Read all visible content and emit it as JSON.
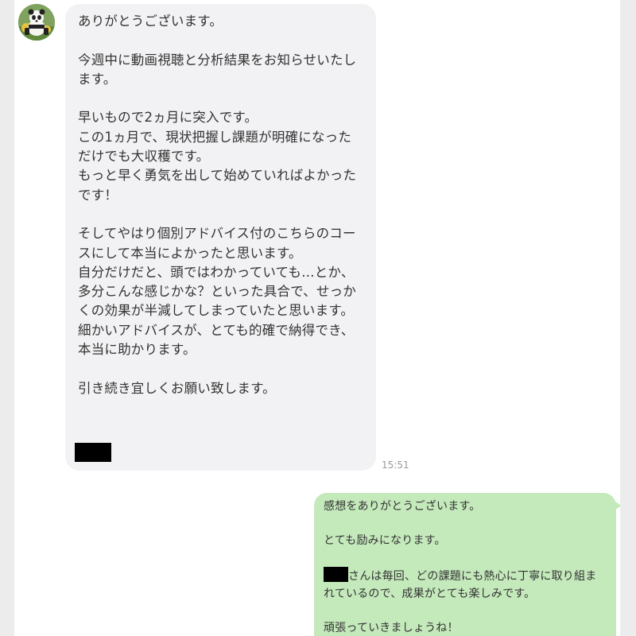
{
  "chat": {
    "incoming": {
      "avatar_icon": "panda-avatar-icon",
      "text": "ありがとうございます。\n\n今週中に動画視聴と分析結果をお知らせいたします。\n\n早いもので2ヵ月に突入です。\nこの1ヵ月で、現状把握し課題が明確になっただけでも大収穫です。\nもっと早く勇気を出して始めていればよかったです！\n\nそしてやはり個別アドバイス付のこちらのコースにして本当によかったと思います。\n自分だけだと、頭ではわかっていても…とか、多分こんな感じかな？といった具合で、せっかくの効果が半減してしまっていたと思います。\n細かいアドバイスが、とても的確で納得でき、本当に助かります。\n\n引き続き宜しくお願い致します。",
      "timestamp": "15:51"
    },
    "outgoing": {
      "line1": "感想をありがとうございます。",
      "line2": "とても励みになります。",
      "line3_after_redaction": "さんは毎回、どの課題にも熱心に丁寧に取り組まれているので、成果がとても楽しみです。",
      "line4": "頑張っていきましょうね！"
    }
  },
  "colors": {
    "incoming_bubble": "#f2f2f4",
    "outgoing_bubble": "#c4e9bb",
    "text": "#333333",
    "timestamp": "#9a9a9a"
  }
}
